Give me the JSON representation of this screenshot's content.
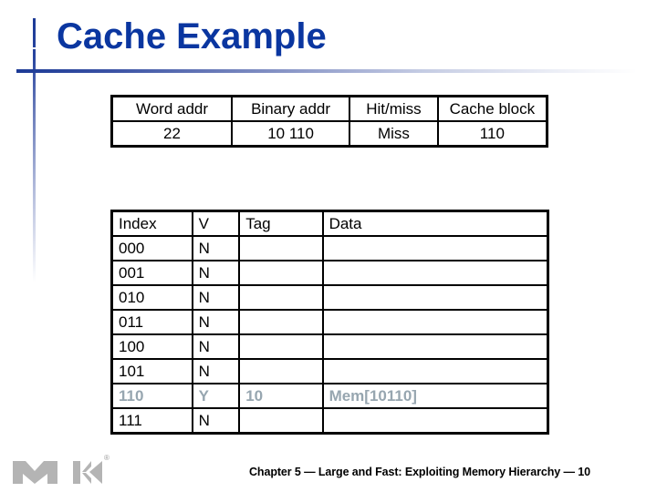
{
  "slide": {
    "title": "Cache Example",
    "accent_color": "#0a36a0",
    "highlight_color": "#97a6b0"
  },
  "access_table": {
    "headers": [
      "Word addr",
      "Binary addr",
      "Hit/miss",
      "Cache block"
    ],
    "rows": [
      [
        "22",
        "10 110",
        "Miss",
        "110"
      ]
    ]
  },
  "cache_table": {
    "headers": [
      "Index",
      "V",
      "Tag",
      "Data"
    ],
    "rows": [
      [
        "000",
        "N",
        "",
        ""
      ],
      [
        "001",
        "N",
        "",
        ""
      ],
      [
        "010",
        "N",
        "",
        ""
      ],
      [
        "011",
        "N",
        "",
        ""
      ],
      [
        "100",
        "N",
        "",
        ""
      ],
      [
        "101",
        "N",
        "",
        ""
      ],
      [
        "110",
        "Y",
        "10",
        "Mem[10110]"
      ],
      [
        "111",
        "N",
        "",
        ""
      ]
    ],
    "highlighted_row_index": "110"
  },
  "footer": {
    "text": "Chapter 5 — Large and Fast: Exploiting Memory Hierarchy — 10",
    "logo": "morgan-kaufmann-logo",
    "registered_mark": "®"
  }
}
